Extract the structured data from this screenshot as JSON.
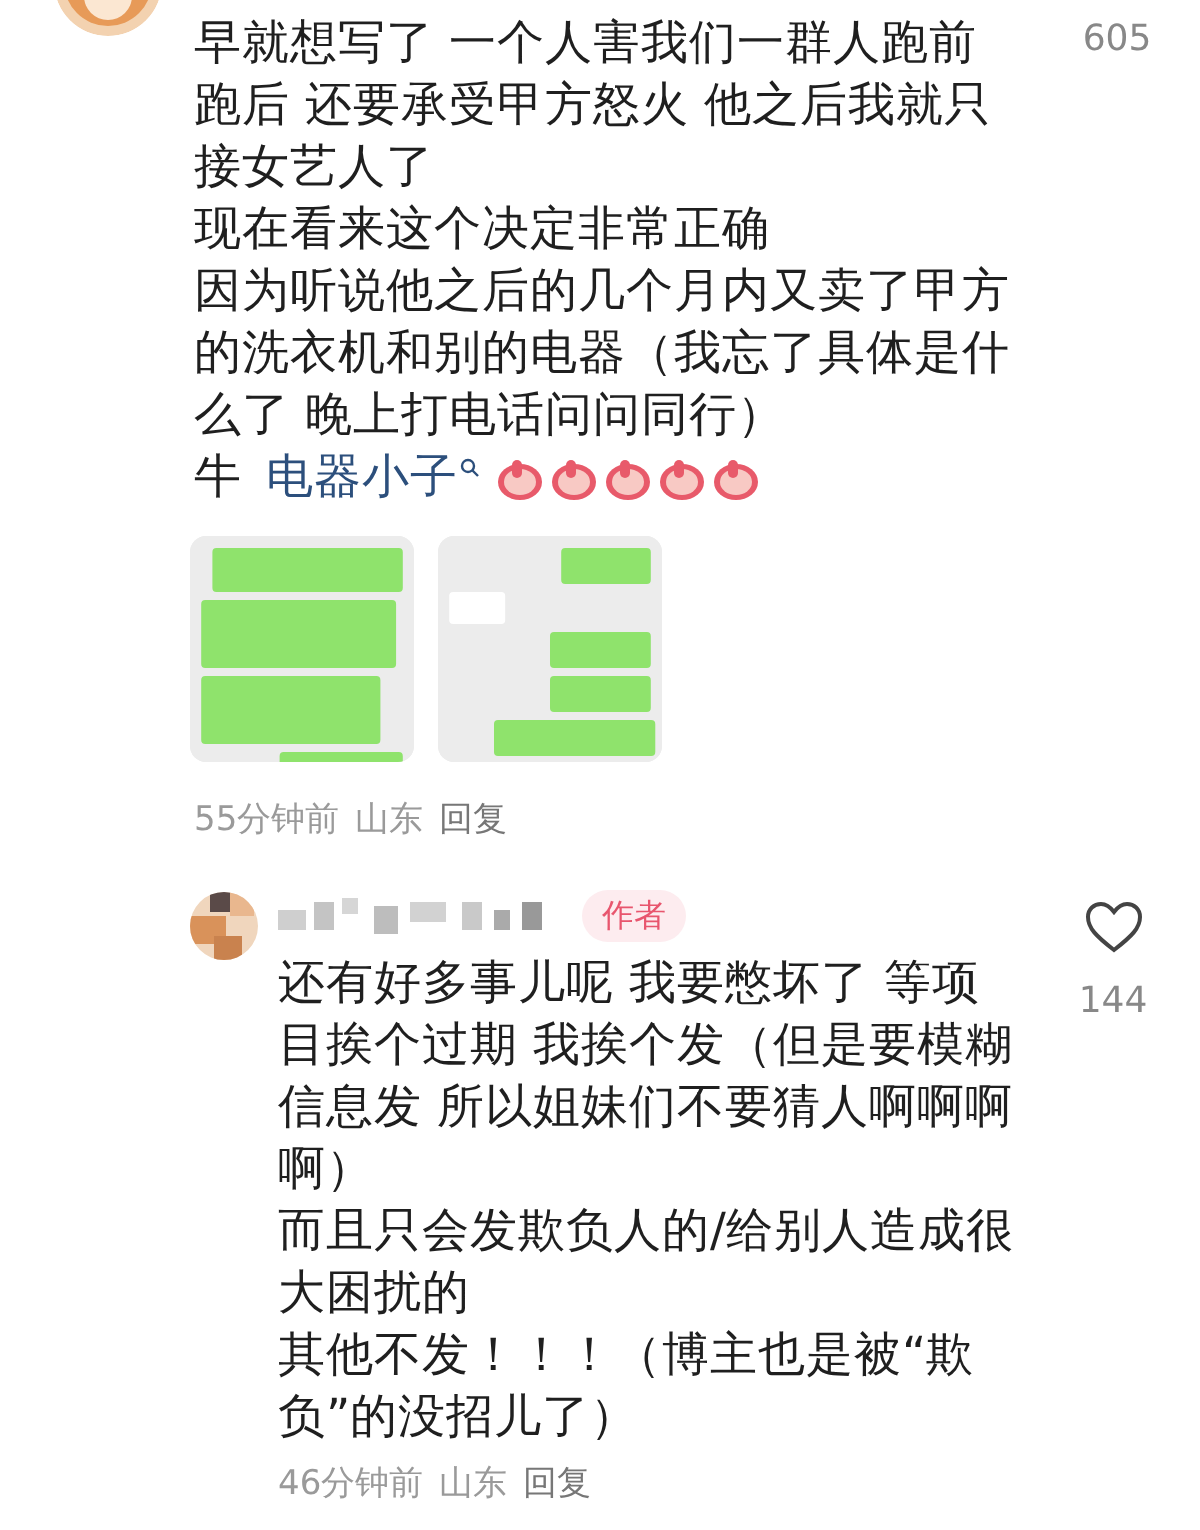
{
  "comments": [
    {
      "kind": "comment",
      "likes": "605",
      "paragraphs": [
        "早就想写了 一个人害我们一群人跑前跑后 还要承受甲方怒火 他之后我就只接女艺人了",
        "现在看来这个决定非常正确",
        "因为听说他之后的几个月内又卖了甲方的洗衣机和别的电器（我忘了具体是什么了 晚上打电话问问同行）"
      ],
      "tag_line": {
        "prefix": "牛",
        "tag": "电器小子"
      },
      "meta": {
        "time": "55分钟前",
        "location": "山东",
        "reply": "回复"
      }
    },
    {
      "kind": "reply",
      "badge": "作者",
      "liked": false,
      "likes": "144",
      "paragraphs": [
        "还有好多事儿呢 我要憋坏了 等项目挨个过期 我挨个发（但是要模糊信息发 所以姐妹们不要猜人啊啊啊啊）",
        "而且只会发欺负人的/给别人造成很大困扰的",
        "其他不发！！！（博主也是被“欺负”的没招儿了）"
      ],
      "meta": {
        "time": "46分钟前",
        "location": "山东",
        "reply": "回复"
      }
    }
  ]
}
